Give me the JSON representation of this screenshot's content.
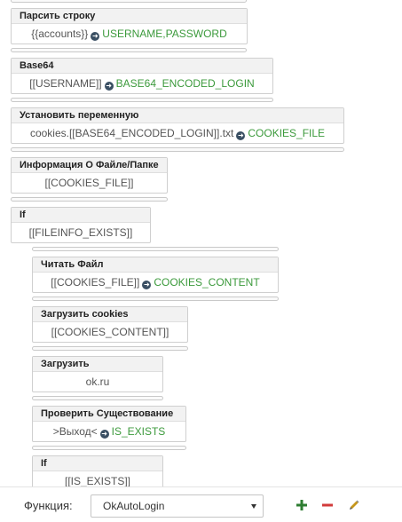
{
  "blocks": [
    {
      "title": "Парсить строку",
      "value": "{{accounts}}",
      "output": "USERNAME,PASSWORD"
    },
    {
      "title": "Base64",
      "value": "[[USERNAME]]",
      "output": "BASE64_ENCODED_LOGIN"
    },
    {
      "title": "Установить переменную",
      "value": "cookies.[[BASE64_ENCODED_LOGIN]].txt",
      "output": "COOKIES_FILE"
    },
    {
      "title": "Информация О Файле/Папке",
      "value": "[[COOKIES_FILE]]"
    },
    {
      "title": "If",
      "value": "[[FILEINFO_EXISTS]]"
    },
    {
      "title": "Читать Файл",
      "value": "[[COOKIES_FILE]]",
      "output": "COOKIES_CONTENT"
    },
    {
      "title": "Загрузить cookies",
      "value": "[[COOKIES_CONTENT]]"
    },
    {
      "title": "Загрузить",
      "value": "ok.ru"
    },
    {
      "title": "Проверить Существование",
      "value": ">Выход<",
      "output": "IS_EXISTS"
    },
    {
      "title": "If",
      "value": "[[IS_EXISTS]]"
    }
  ],
  "footer": {
    "function_label": "Функция:",
    "function_value": "OkAutoLogin"
  },
  "icons": {
    "arrow": "arrow-right-circle-icon",
    "add": "plus-icon",
    "remove": "minus-icon",
    "edit": "pencil-icon"
  },
  "colors": {
    "output_text": "#3c9a3c",
    "add_icon": "#2e7d32",
    "remove_icon": "#d23b3b",
    "edit_icon": "#c6961b"
  }
}
